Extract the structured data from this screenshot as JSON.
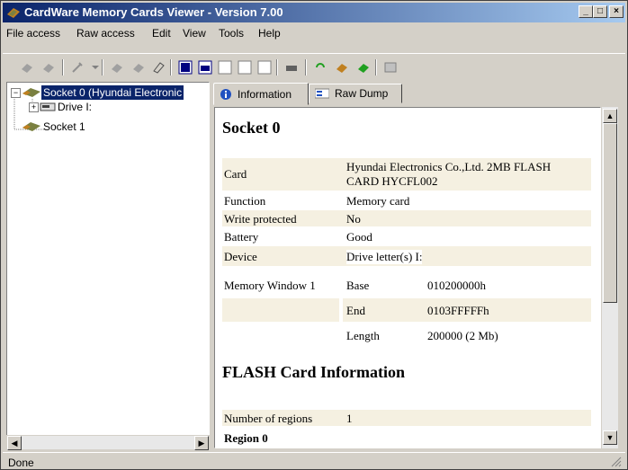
{
  "window": {
    "title": "CardWare Memory Cards Viewer - Version 7.00"
  },
  "titlebar_buttons": {
    "minimize": "_",
    "maximize": "□",
    "close": "×"
  },
  "menu": [
    "File access",
    "Raw access",
    "Edit",
    "View",
    "Tools",
    "Help"
  ],
  "tree": {
    "nodes": [
      "Socket 0 (Hyundai Electronic",
      "Drive I:",
      "Socket 1"
    ],
    "expander_minus": "−",
    "expander_plus": "+"
  },
  "tabs": [
    "Information",
    "Raw Dump"
  ],
  "info": {
    "heading": "Socket 0",
    "rows": [
      {
        "label": "Card",
        "value": "Hyundai Electronics Co.,Ltd. 2MB FLASH",
        "value2": "CARD HYCFL002"
      },
      {
        "label": "Function",
        "value": "Memory card"
      },
      {
        "label": "Write protected",
        "value": "No"
      },
      {
        "label": "Battery",
        "value": "Good"
      },
      {
        "label": "Device",
        "value": "Drive letter(s) I:"
      }
    ],
    "memory_window": {
      "label": "Memory Window 1",
      "base_label": "Base",
      "base": "010200000h",
      "end_label": "End",
      "end": "0103FFFFFh",
      "length_label": "Length",
      "length": "200000 (2 Mb)"
    },
    "flash_heading": "FLASH Card Information",
    "regions_label": "Number of regions",
    "regions": "1",
    "region0": "Region 0"
  },
  "status": "Done",
  "colors": {
    "title_start": "#0a246a",
    "title_end": "#a6caf0",
    "selection": "#0a246a",
    "shade": "#f5f0e1"
  }
}
